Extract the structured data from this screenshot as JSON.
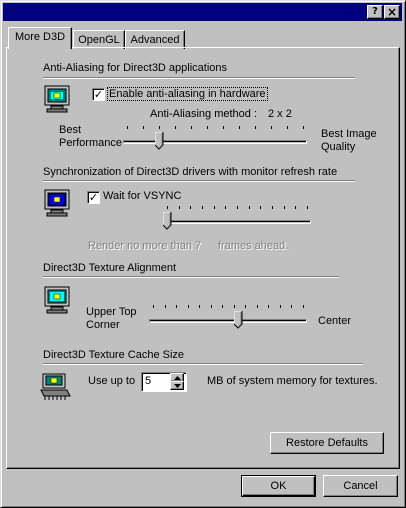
{
  "window": {
    "help_button": "?",
    "close_button": "×"
  },
  "tabs": [
    {
      "label": "More D3D"
    },
    {
      "label": "OpenGL"
    },
    {
      "label": "Advanced"
    }
  ],
  "antialiasing": {
    "title": "Anti-Aliasing for Direct3D applications",
    "checkbox_label": "Enable anti-aliasing in hardware",
    "checked": true,
    "method_label": "Anti-Aliasing method :",
    "method_value": "2 x 2",
    "left_label_1": "Best",
    "left_label_2": "Performance",
    "right_label_1": "Best Image",
    "right_label_2": "Quality",
    "slider_fraction": 0.18
  },
  "vsync": {
    "title": "Synchronization of Direct3D drivers with monitor refresh rate",
    "checkbox_label": "Wait for VSYNC",
    "checked": true,
    "render_prefix": "Render no more than",
    "render_value": "7",
    "render_suffix": "frames ahead.",
    "slider_fraction": 0.0
  },
  "alignment": {
    "title": "Direct3D Texture Alignment",
    "left_label_1": "Upper Top",
    "left_label_2": "Corner",
    "right_label": "Center",
    "slider_fraction": 0.57
  },
  "cache": {
    "title": "Direct3D Texture Cache Size",
    "prefix": "Use up to",
    "value": "5",
    "suffix": "MB of system memory for textures."
  },
  "buttons": {
    "restore": "Restore Defaults",
    "ok": "OK",
    "cancel": "Cancel"
  },
  "colors": {
    "face": "#c0c0c0",
    "titlebar": "#000080",
    "disabled_text": "#808080"
  }
}
